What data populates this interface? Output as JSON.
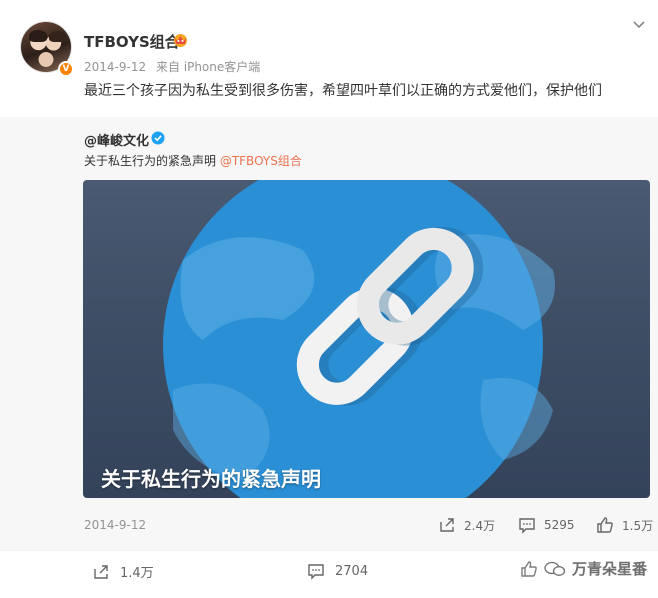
{
  "post": {
    "username": "TFBOYS组合",
    "date": "2014-9-12",
    "source": "来自 iPhone客户端",
    "text": "最近三个孩子因为私生受到很多伤害，希望四叶草们以正确的方式爱他们，保护他们",
    "verified_badge": "V"
  },
  "repost": {
    "orig_user": "@峰峻文化",
    "orig_text_prefix": "关于私生行为的紧急声明 ",
    "orig_mention": "@TFBOYS组合",
    "card_title": "关于私生行为的紧急声明",
    "date": "2014-9-12",
    "share_count": "2.4万",
    "comment_count": "5295",
    "like_count": "1.5万"
  },
  "footer": {
    "share_count": "1.4万",
    "comment_count": "2704",
    "watermark": "万青朵星番"
  },
  "colors": {
    "mention": "#eb7350",
    "badge": "#ff8200",
    "verified": "#1da1f2",
    "card_blue": "#2b8fd6"
  },
  "icons": [
    "crown-icon",
    "chevron-down-icon",
    "verified-icon",
    "link-icon",
    "share-icon",
    "comment-icon",
    "like-icon"
  ]
}
